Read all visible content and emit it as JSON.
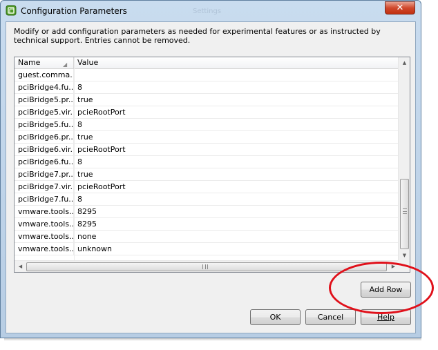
{
  "window": {
    "title": "Configuration Parameters",
    "ghost_title": "Settings",
    "close_glyph": "✕"
  },
  "description": "Modify or add configuration parameters as needed for experimental features or as instructed by technical support. Entries cannot be removed.",
  "grid": {
    "columns": [
      "Name",
      "Value"
    ],
    "sort_icon": "sort-icon",
    "rows": [
      {
        "name": "guest.comma...",
        "value": ""
      },
      {
        "name": "pciBridge4.fu...",
        "value": "8"
      },
      {
        "name": "pciBridge5.pr...",
        "value": "true"
      },
      {
        "name": "pciBridge5.vir...",
        "value": "pcieRootPort"
      },
      {
        "name": "pciBridge5.fu...",
        "value": "8"
      },
      {
        "name": "pciBridge6.pr...",
        "value": "true"
      },
      {
        "name": "pciBridge6.vir...",
        "value": "pcieRootPort"
      },
      {
        "name": "pciBridge6.fu...",
        "value": "8"
      },
      {
        "name": "pciBridge7.pr...",
        "value": "true"
      },
      {
        "name": "pciBridge7.vir...",
        "value": "pcieRootPort"
      },
      {
        "name": "pciBridge7.fu...",
        "value": "8"
      },
      {
        "name": "vmware.tools....",
        "value": "8295"
      },
      {
        "name": "vmware.tools....",
        "value": "8295"
      },
      {
        "name": "vmware.tools....",
        "value": "none"
      },
      {
        "name": "vmware.tools....",
        "value": "unknown"
      }
    ]
  },
  "buttons": {
    "add_row": "Add Row",
    "ok": "OK",
    "cancel": "Cancel",
    "help": "Help"
  },
  "annotation": {
    "color": "#e0101a"
  }
}
